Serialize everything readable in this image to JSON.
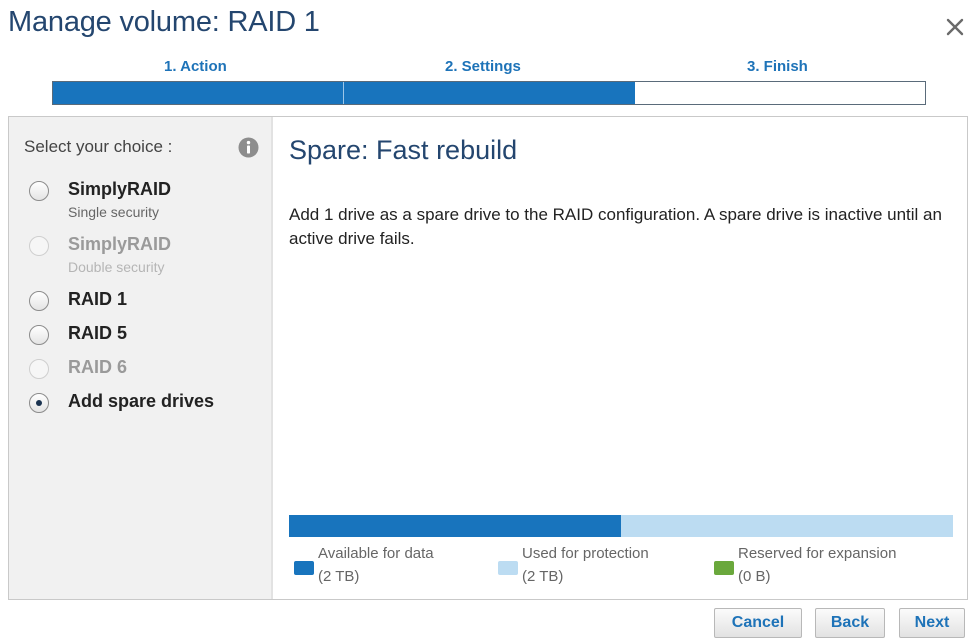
{
  "window": {
    "title": "Manage volume: RAID 1",
    "close_icon": "close-icon"
  },
  "wizard": {
    "steps": [
      {
        "label": "1. Action"
      },
      {
        "label": "2. Settings"
      },
      {
        "label": "3. Finish"
      }
    ],
    "progress_fraction": 0.667,
    "accent_color": "#1874bd"
  },
  "sidebar": {
    "select_label": "Select your choice :",
    "info_icon": "info-icon",
    "options": [
      {
        "title": "SimplyRAID",
        "subtitle": "Single security",
        "enabled": true,
        "selected": false
      },
      {
        "title": "SimplyRAID",
        "subtitle": "Double security",
        "enabled": false,
        "selected": false
      },
      {
        "title": "RAID 1",
        "enabled": true,
        "selected": false
      },
      {
        "title": "RAID 5",
        "enabled": true,
        "selected": false
      },
      {
        "title": "RAID 6",
        "enabled": false,
        "selected": false
      },
      {
        "title": "Add spare drives",
        "enabled": true,
        "selected": true
      }
    ]
  },
  "main": {
    "title": "Spare: Fast rebuild",
    "description": "Add 1 drive as a spare drive to the RAID configuration. A spare drive is inactive until an active drive fails.",
    "usage": {
      "available_fraction": 0.5,
      "legend": [
        {
          "name": "Available for data",
          "size": "(2 TB)",
          "color": "#1874bd"
        },
        {
          "name": "Used for protection",
          "size": "(2 TB)",
          "color": "#bcdcf2"
        },
        {
          "name": "Reserved for expansion",
          "size": "(0 B)",
          "color": "#6aa83c"
        }
      ]
    }
  },
  "footer": {
    "cancel_label": "Cancel",
    "back_label": "Back",
    "next_label": "Next"
  }
}
